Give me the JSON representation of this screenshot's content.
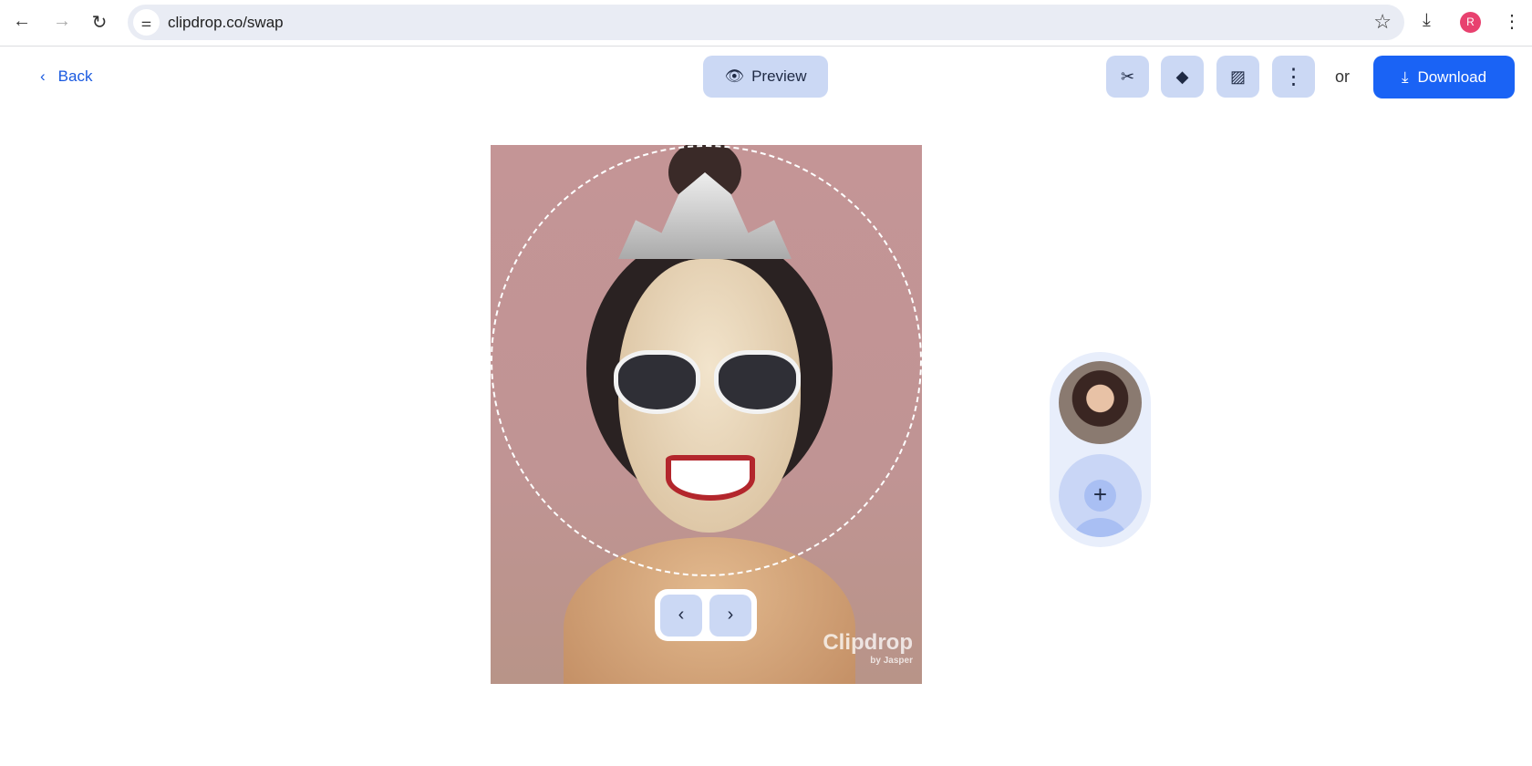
{
  "browser": {
    "url": "clipdrop.co/swap",
    "profile_initial": "R"
  },
  "header": {
    "back_label": "Back",
    "preview_label": "Preview",
    "or_label": "or",
    "download_label": "Download"
  },
  "tools": [
    "cut-icon",
    "eraser-icon",
    "edit-image-icon",
    "more-icon"
  ],
  "canvas": {
    "watermark": "Clipdrop",
    "watermark_sub": "by Jasper"
  },
  "colors": {
    "accent": "#1a63f5",
    "soft_button": "#cbd8f4"
  }
}
